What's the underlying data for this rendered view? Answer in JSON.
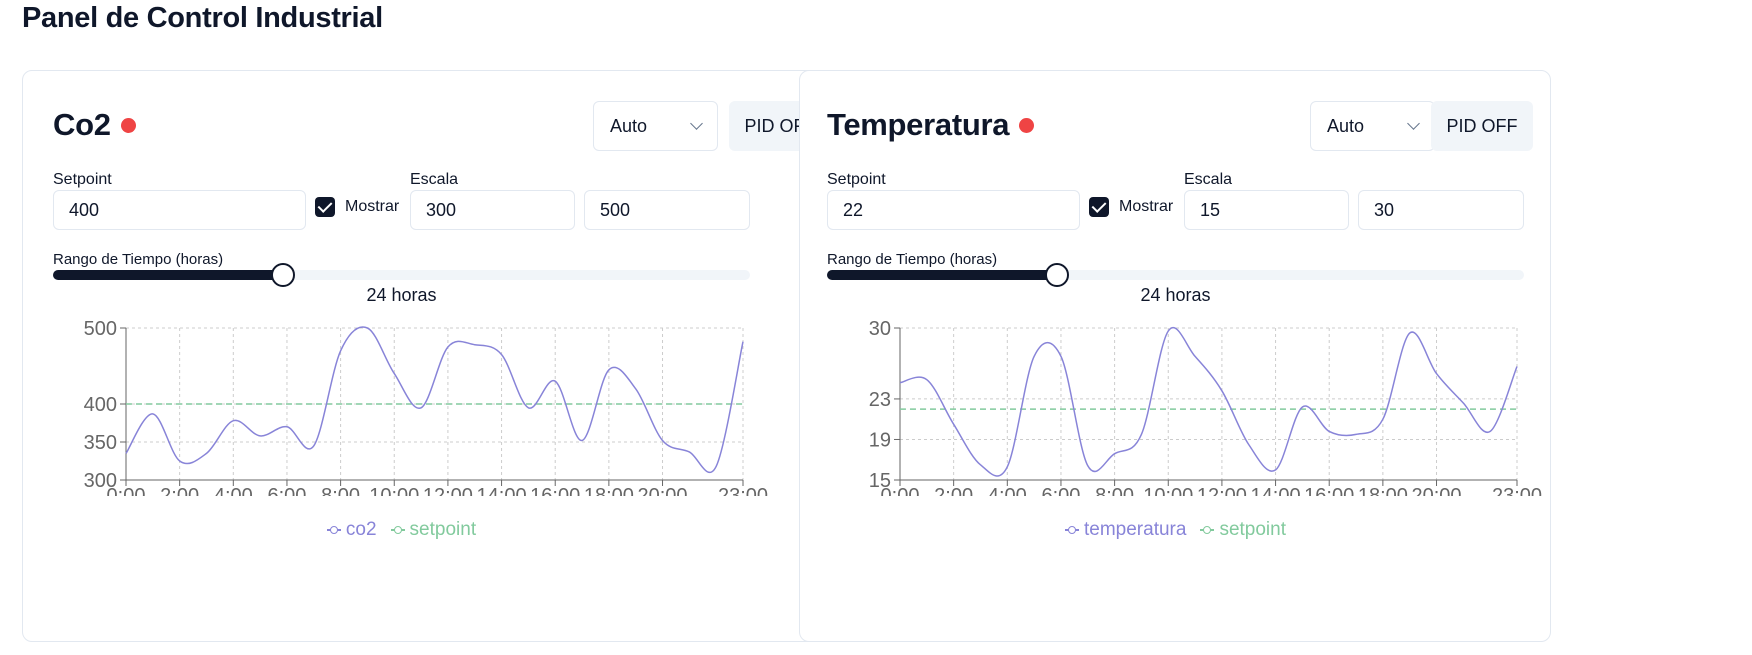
{
  "page": {
    "title": "Panel de Control Industrial"
  },
  "colors": {
    "series": "#8884d8",
    "setpoint": "#82ca9d",
    "status_off": "#ef4444",
    "accent_dark": "#0f172a"
  },
  "panels": [
    {
      "title": "Co2",
      "status_icon": "status-dot-icon",
      "mode": "Auto",
      "pid_label": "PID OFF",
      "setpoint_label": "Setpoint",
      "setpoint_value": "400",
      "show_label": "Mostrar",
      "show_checked": true,
      "scale_label": "Escala",
      "scale_min": "300",
      "scale_max": "500",
      "range_label": "Rango de Tiempo (horas)",
      "range_fraction": 0.33,
      "range_value": "24 horas",
      "legend_series": "co2",
      "legend_setpoint": "setpoint"
    },
    {
      "title": "Temperatura",
      "status_icon": "status-dot-icon",
      "mode": "Auto",
      "pid_label": "PID OFF",
      "setpoint_label": "Setpoint",
      "setpoint_value": "22",
      "show_label": "Mostrar",
      "show_checked": true,
      "scale_label": "Escala",
      "scale_min": "15",
      "scale_max": "30",
      "range_label": "Rango de Tiempo (horas)",
      "range_fraction": 0.33,
      "range_value": "24 horas",
      "legend_series": "temperatura",
      "legend_setpoint": "setpoint"
    }
  ],
  "chart_data": [
    {
      "type": "line",
      "x": [
        0,
        1,
        2,
        3,
        4,
        5,
        6,
        7,
        8,
        9,
        10,
        11,
        12,
        13,
        14,
        15,
        16,
        17,
        18,
        19,
        20,
        21,
        22,
        23
      ],
      "x_tick_labels": [
        "0:00",
        "2:00",
        "4:00",
        "6:00",
        "8:00",
        "10:00",
        "12:00",
        "14:00",
        "16:00",
        "18:00",
        "20:00",
        "23:00"
      ],
      "x_tick_positions": [
        0,
        2,
        4,
        6,
        8,
        10,
        12,
        14,
        16,
        18,
        20,
        23
      ],
      "y_ticks": [
        300,
        350,
        400,
        500
      ],
      "ylim": [
        300,
        500
      ],
      "series": [
        {
          "name": "co2",
          "values": [
            335,
            387,
            325,
            335,
            378,
            358,
            370,
            345,
            470,
            500,
            440,
            395,
            475,
            478,
            465,
            395,
            430,
            352,
            445,
            420,
            352,
            337,
            318,
            482
          ]
        },
        {
          "name": "setpoint",
          "values": [
            400,
            400,
            400,
            400,
            400,
            400,
            400,
            400,
            400,
            400,
            400,
            400,
            400,
            400,
            400,
            400,
            400,
            400,
            400,
            400,
            400,
            400,
            400,
            400
          ]
        }
      ],
      "grid": true,
      "legend": "bottom-center"
    },
    {
      "type": "line",
      "x": [
        0,
        1,
        2,
        3,
        4,
        5,
        6,
        7,
        8,
        9,
        10,
        11,
        12,
        13,
        14,
        15,
        16,
        17,
        18,
        19,
        20,
        21,
        22,
        23
      ],
      "x_tick_labels": [
        "0:00",
        "2:00",
        "4:00",
        "6:00",
        "8:00",
        "10:00",
        "12:00",
        "14:00",
        "16:00",
        "18:00",
        "20:00",
        "23:00"
      ],
      "x_tick_positions": [
        0,
        2,
        4,
        6,
        8,
        10,
        12,
        14,
        16,
        18,
        20,
        23
      ],
      "y_ticks": [
        15,
        19,
        23,
        30
      ],
      "ylim": [
        15,
        30
      ],
      "series": [
        {
          "name": "temperatura",
          "values": [
            24.6,
            24.9,
            20.5,
            16.5,
            16.3,
            27.2,
            27.2,
            16.4,
            17.6,
            19.5,
            29.7,
            27.2,
            23.8,
            18.5,
            16.0,
            22.2,
            19.8,
            19.5,
            21.0,
            29.5,
            25.5,
            22.6,
            19.8,
            26.2
          ]
        },
        {
          "name": "setpoint",
          "values": [
            22,
            22,
            22,
            22,
            22,
            22,
            22,
            22,
            22,
            22,
            22,
            22,
            22,
            22,
            22,
            22,
            22,
            22,
            22,
            22,
            22,
            22,
            22,
            22
          ]
        }
      ],
      "grid": true,
      "legend": "bottom-center"
    }
  ]
}
